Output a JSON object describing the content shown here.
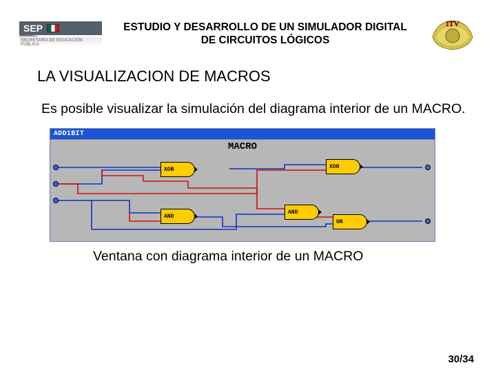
{
  "header": {
    "sep_label": "SEP",
    "sep_subtitle": "SECRETARÍA DE EDUCACIÓN PÚBLICA",
    "title_line1": "ESTUDIO Y DESARROLLO DE UN SIMULADOR DIGITAL",
    "title_line2": "DE CIRCUITOS LÓGICOS",
    "itv_label": "ITV"
  },
  "section_title": "LA VISUALIZACION DE MACROS",
  "body_text": "Es posible visualizar la simulación del diagrama interior de un MACRO.",
  "macro": {
    "window_title": "ADD1BIT",
    "canvas_label": "MACRO",
    "gates": {
      "xor1": "XOR",
      "xor2": "XOR",
      "and1": "AND",
      "and2": "AND",
      "or1": "OR"
    }
  },
  "caption": "Ventana con diagrama interior de un MACRO",
  "page_number": "30/34"
}
